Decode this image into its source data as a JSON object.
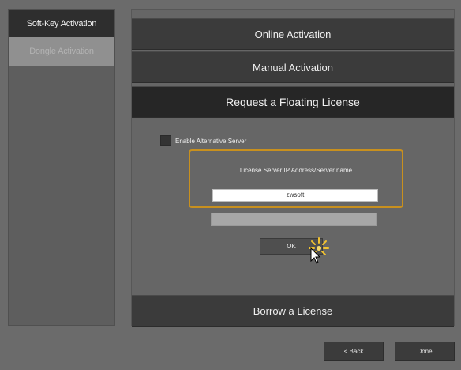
{
  "sidebar": {
    "tabs": [
      {
        "label": "Soft-Key Activation"
      },
      {
        "label": "Dongle Activation"
      }
    ]
  },
  "main": {
    "buttons": [
      {
        "label": "Online Activation"
      },
      {
        "label": "Manual Activation"
      },
      {
        "label": "Request a Floating License"
      },
      {
        "label": "Borrow a License"
      }
    ],
    "alt_server_checkbox_label": "Enable Alternative Server",
    "server_label": "License Server IP Address/Server name",
    "server_value": "zwsoft",
    "ok_label": "OK"
  },
  "footer": {
    "back_label": "< Back",
    "done_label": "Done"
  },
  "colors": {
    "accent_border": "#c8901e",
    "selected_button": "#262626",
    "button": "#3b3b3b"
  }
}
